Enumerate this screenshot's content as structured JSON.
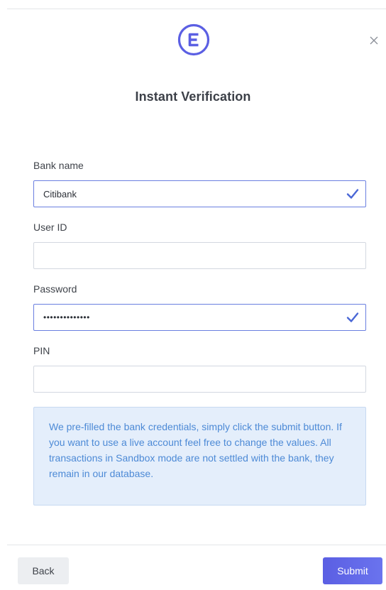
{
  "header": {
    "title": "Instant Verification",
    "logo_icon": "e-logo-icon",
    "close_icon": "close-icon",
    "close_glyph": "×"
  },
  "form": {
    "bank_name": {
      "label": "Bank name",
      "value": "Citibank",
      "valid": true
    },
    "user_id": {
      "label": "User ID",
      "value": "",
      "valid": false
    },
    "password": {
      "label": "Password",
      "value": "••••••••••••••",
      "valid": true
    },
    "pin": {
      "label": "PIN",
      "value": "",
      "valid": false
    }
  },
  "notice": {
    "text": "We pre-filled the bank credentials, simply click the submit button. If you want to use a live account feel free to change the values. All transactions in Sandbox mode are not settled with the bank, they remain in our database."
  },
  "footer": {
    "back_label": "Back",
    "submit_label": "Submit"
  },
  "colors": {
    "accent": "#5b5fe3",
    "valid_border": "#6a7fe0",
    "check": "#4a67d6",
    "notice_bg": "#e4eefb",
    "notice_text": "#4d8ad6"
  }
}
